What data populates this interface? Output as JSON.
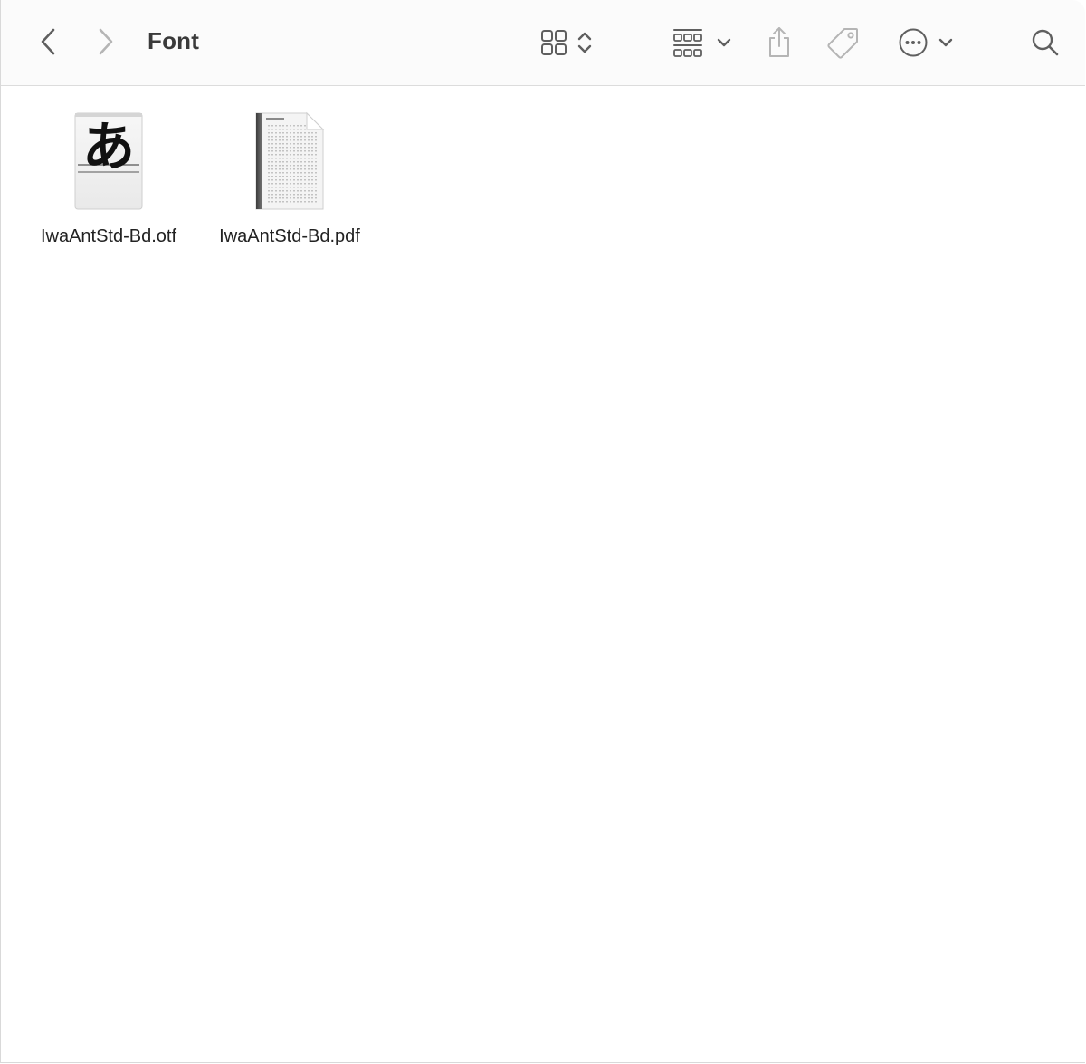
{
  "window": {
    "title": "Font"
  },
  "toolbar": {
    "back": {
      "icon": "chevron-left-icon"
    },
    "forward": {
      "icon": "chevron-right-icon"
    },
    "view_mode": {
      "icon": "icon-grid-icon"
    },
    "group_by": {
      "icon": "group-grid-icon"
    },
    "share": {
      "icon": "share-icon"
    },
    "tags": {
      "icon": "tag-icon"
    },
    "more": {
      "icon": "ellipsis-circle-icon"
    },
    "search": {
      "icon": "search-icon"
    }
  },
  "files": [
    {
      "name": "IwaAntStd-Bd.otf",
      "kind": "font",
      "glyph": "あ"
    },
    {
      "name": "IwaAntStd-Bd.pdf",
      "kind": "pdf"
    }
  ],
  "colors": {
    "toolbar_bg": "#fbfbfb",
    "icon": "#5f5f5f",
    "icon_disabled": "#b5b5b5",
    "text": "#222222"
  }
}
